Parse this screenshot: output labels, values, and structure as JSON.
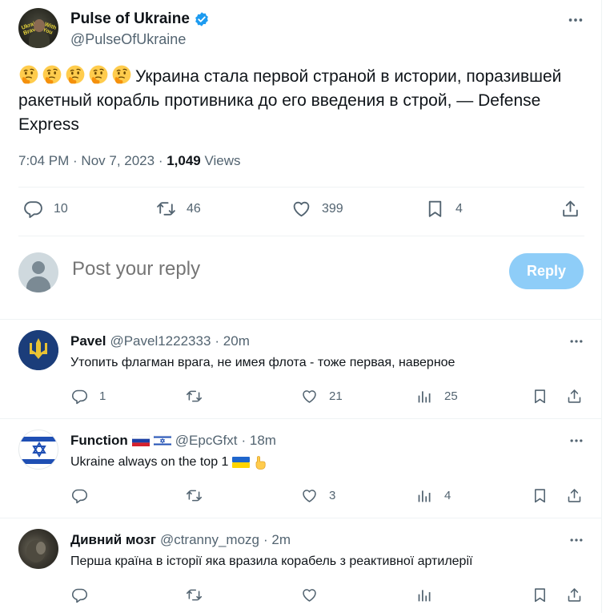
{
  "colors": {
    "accent": "#1d9bf0",
    "text": "#0f1419",
    "muted": "#536471",
    "reply_button": "#8ecdf8"
  },
  "main": {
    "name": "Pulse of Ukraine",
    "handle": "@PulseOfUkraine",
    "avatar_text_left": "Ukraine Brave",
    "avatar_text_right": "With You",
    "emoji": [
      "thinking-face",
      "thinking-face",
      "thinking-face",
      "thinking-face",
      "thinking-face"
    ],
    "text": "Украина стала первой страной в истории, поразившей ракетный корабль противника до его введения в строй, — Defense Express",
    "time": "7:04 PM · Nov 7, 2023 · ",
    "views_count": "1,049",
    "views_label": " Views",
    "stats": {
      "replies": "10",
      "reposts": "46",
      "likes": "399",
      "bookmarks": "4"
    }
  },
  "composer": {
    "placeholder": "Post your reply",
    "button": "Reply"
  },
  "replies": [
    {
      "name": "Pavel",
      "handle": "@Pavel1222333",
      "time": "· 20m",
      "text": "Утопить флагман врага, не имея флота - тоже первая, наверное",
      "replies": "1",
      "reposts": "",
      "likes": "21",
      "views": "25"
    },
    {
      "name": "Function",
      "name_flags": [
        "russia-flag",
        "israel-flag"
      ],
      "handle": "@EpcGfxt",
      "time": "· 18m",
      "text": "Ukraine always on the top 1",
      "text_emoji": [
        "ukraine-flag",
        "index-pointing-up"
      ],
      "replies": "",
      "reposts": "",
      "likes": "3",
      "views": "4"
    },
    {
      "name": "Дивний мозг",
      "handle": "@ctranny_mozg",
      "time": "· 2m",
      "text": "Перша країна в історії яка вразила корабель з реактивної артилерії",
      "replies": "",
      "reposts": "",
      "likes": "",
      "views": ""
    }
  ]
}
